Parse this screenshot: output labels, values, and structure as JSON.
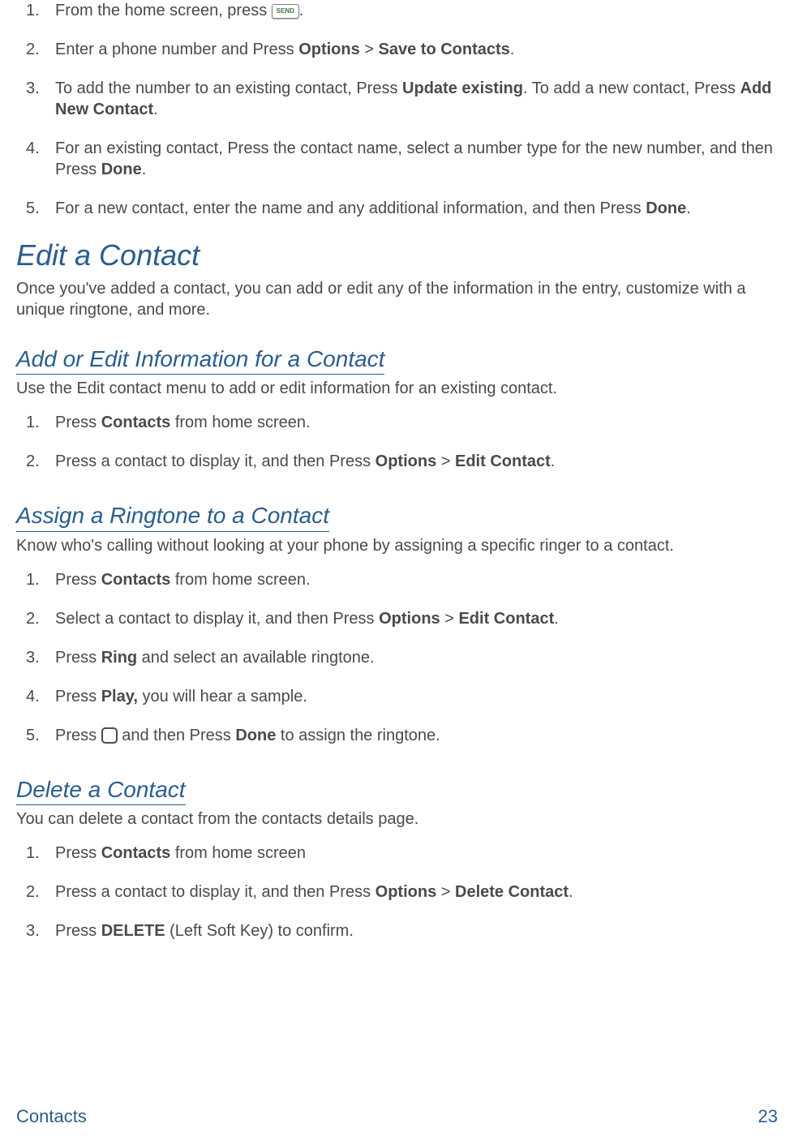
{
  "list1": {
    "i1": {
      "n": "1.",
      "a": "From the home screen, press",
      "c": "."
    },
    "i2": {
      "n": "2.",
      "a": "Enter a phone number and Press ",
      "b1": "Options",
      "m": " > ",
      "b2": "Save to Contacts",
      "c": "."
    },
    "i3": {
      "n": "3.",
      "a": "To add the number to an existing contact, Press ",
      "b1": "Update existing",
      "m": ". To add a new contact, Press ",
      "b2": "Add New Contact",
      "c": "."
    },
    "i4": {
      "n": "4.",
      "a": "For an existing contact, Press the contact name, select a number type for the new number, and then Press ",
      "b1": "Done",
      "c": "."
    },
    "i5": {
      "n": "5.",
      "a": "For a new contact, enter the name and any additional information, and then Press ",
      "b1": "Done",
      "c": "."
    }
  },
  "sec_edit": {
    "h": "Edit a Contact",
    "p": "Once you've added a contact, you can add or edit any of the information in the entry, customize with a unique ringtone, and more."
  },
  "sec_addedit": {
    "h": "Add or Edit Information for a Contact",
    "p": "Use the Edit contact menu to add or edit information for an existing contact.",
    "i1": {
      "n": "1.",
      "a": "Press ",
      "b1": "Contacts",
      "c": " from home screen."
    },
    "i2": {
      "n": "2.",
      "a": "Press a contact to display it, and then Press ",
      "b1": "Options",
      "m": " > ",
      "b2": "Edit Contact",
      "c": "."
    }
  },
  "sec_ring": {
    "h": "Assign a Ringtone to a Contact",
    "p": "Know who's calling without looking at your phone by assigning a specific ringer to a contact.",
    "i1": {
      "n": "1.",
      "a": "Press ",
      "b1": "Contacts",
      "c": " from home screen."
    },
    "i2": {
      "n": "2.",
      "a": "Select a contact to display it, and then Press ",
      "b1": "Options",
      "m": " > ",
      "b2": "Edit Contact",
      "c": "."
    },
    "i3": {
      "n": "3.",
      "a": "Press ",
      "b1": "Ring",
      "c": " and select an available ringtone."
    },
    "i4": {
      "n": "4.",
      "a": "Press ",
      "b1": "Play,",
      "c": " you will hear a sample."
    },
    "i5": {
      "n": "5.",
      "a": "Press ",
      "m": " and then Press ",
      "b2": "Done",
      "c": " to assign the ringtone."
    }
  },
  "sec_del": {
    "h": "Delete a Contact",
    "p": "You can delete a contact from the contacts details page.",
    "i1": {
      "n": "1.",
      "a": "Press ",
      "b1": "Contacts",
      "c": " from home screen"
    },
    "i2": {
      "n": "2.",
      "a": "Press a contact to display it, and then Press ",
      "b1": "Options",
      "m": " > ",
      "b2": "Delete Contact",
      "c": "."
    },
    "i3": {
      "n": "3.",
      "a": "Press ",
      "b1": "DELETE",
      "c": " (Left Soft Key) to confirm."
    }
  },
  "footer": {
    "section": "Contacts",
    "page": "23"
  }
}
